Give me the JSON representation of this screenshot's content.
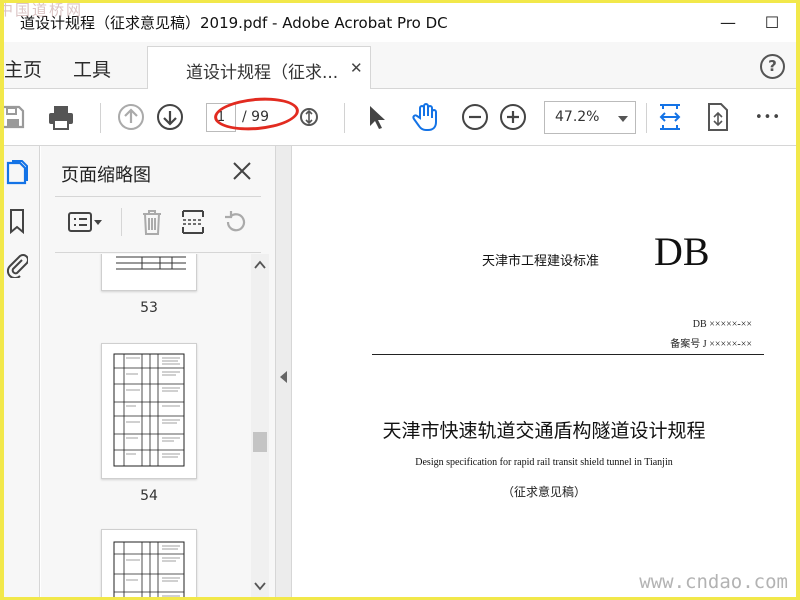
{
  "window": {
    "title": "道设计规程（征求意见稿）2019.pdf - Adobe Acrobat Pro DC",
    "watermark_top": "中国道桥网",
    "minimize_glyph": "—",
    "maximize_glyph": "☐"
  },
  "menubar": {
    "home": "主页",
    "tools": "工具",
    "doc_tab": "道设计规程（征求...",
    "doc_tab_close": "✕",
    "help_glyph": "?"
  },
  "toolbar": {
    "current_page": "1",
    "total_pages": "/ 99",
    "zoom": "47.2%",
    "more_glyph": "•••",
    "icons": [
      "save-icon",
      "print-icon",
      "page-up-icon",
      "page-down-icon",
      "zoom-marquee-icon",
      "select-cursor-icon",
      "hand-tool-icon",
      "zoom-out-icon",
      "zoom-in-icon",
      "fit-width-icon",
      "page-scroll-icon",
      "more-icon"
    ],
    "accent": "#1473e6",
    "annotation_color": "#e22b20"
  },
  "left_rail": {
    "icons": [
      "page-thumbnails-icon",
      "bookmarks-icon",
      "attachments-icon"
    ]
  },
  "thumbnail_panel": {
    "title": "页面缩略图",
    "thumbnails": [
      {
        "page": "53"
      },
      {
        "page": "54"
      },
      {
        "page": ""
      }
    ]
  },
  "document": {
    "standard_label": "天津市工程建设标准",
    "db": "DB",
    "code": "DB ×××××-××",
    "record": "备案号 J ×××××-××",
    "title": "天津市快速轨道交通盾构隧道设计规程",
    "english_title": "Design specification for rapid rail transit shield tunnel in Tianjin",
    "draft": "（征求意见稿）"
  },
  "watermark_bottom": "www.cndao.com",
  "colors": {
    "frame_border": "#f2e84a",
    "panel_bg": "#f7f7f7"
  }
}
